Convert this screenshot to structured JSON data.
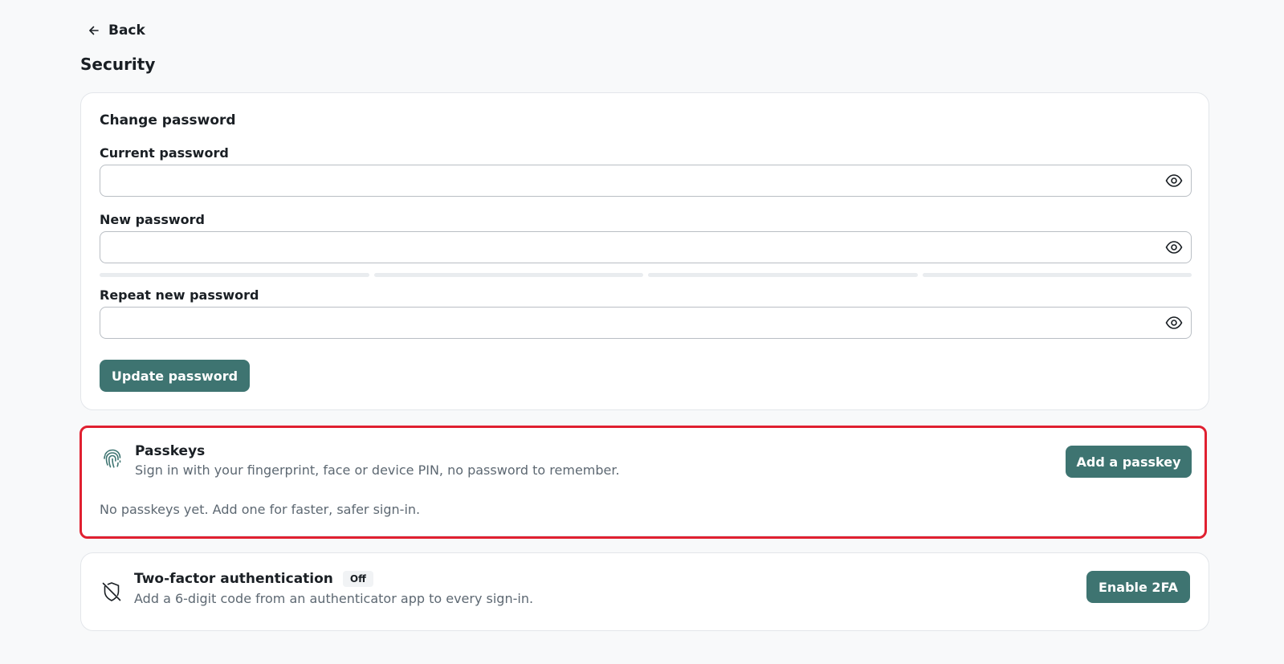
{
  "nav": {
    "back_label": "Back"
  },
  "page": {
    "title": "Security"
  },
  "password_card": {
    "title": "Change password",
    "current": {
      "label": "Current password",
      "value": ""
    },
    "new": {
      "label": "New password",
      "value": "",
      "strength_segments_filled": 0,
      "strength_segments_total": 4
    },
    "repeat": {
      "label": "Repeat new password",
      "value": ""
    },
    "submit_label": "Update password"
  },
  "passkeys": {
    "icon": "fingerprint-icon",
    "title": "Passkeys",
    "description": "Sign in with your fingerprint, face or device PIN, no password to remember.",
    "empty_note": "No passkeys yet. Add one for faster, safer sign-in.",
    "button_label": "Add a passkey"
  },
  "two_factor": {
    "icon": "shield-off-icon",
    "title": "Two-factor authentication",
    "status_badge": "Off",
    "description": "Add a 6-digit code from an authenticator app to every sign-in.",
    "button_label": "Enable 2FA"
  },
  "colors": {
    "primary": "#3e7471",
    "highlight_border": "#e02030",
    "background": "#f8f9fa",
    "muted_text": "#5d6872"
  }
}
